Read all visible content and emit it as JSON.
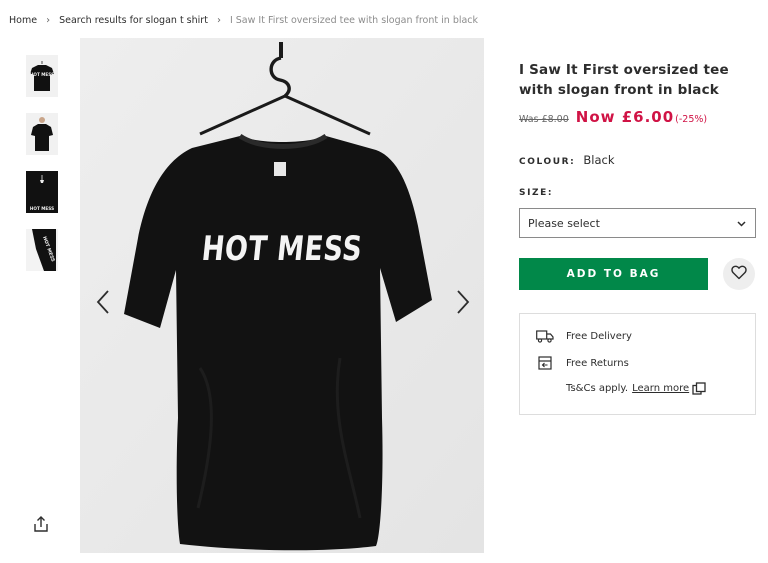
{
  "breadcrumb": {
    "home": "Home",
    "search": "Search results for slogan t shirt",
    "current": "I Saw It First oversized tee with slogan front in black",
    "separator": "›"
  },
  "gallery": {
    "thumbnails": [
      "front-view",
      "model-view",
      "back-view",
      "sleeve-view"
    ],
    "thumb_slogans": [
      "HOT MESS",
      "HOT MESS",
      "HOT MESS"
    ],
    "main_slogan": "HOT MESS",
    "prev_icon": "chevron-left-icon",
    "next_icon": "chevron-right-icon",
    "share_icon": "share-icon"
  },
  "product": {
    "title": "I Saw It First oversized tee with slogan front in black",
    "was_price": "Was £8.00",
    "now_price": "Now £6.00",
    "discount": "(-25%)",
    "colour_label": "COLOUR:",
    "colour_value": "Black",
    "size_label": "SIZE:",
    "size_selected": "Please select",
    "add_to_bag": "ADD TO BAG",
    "wishlist_icon": "heart-icon"
  },
  "delivery": {
    "free_delivery": "Free Delivery",
    "free_returns": "Free Returns",
    "tcs": "Ts&Cs apply.",
    "learn_more": "Learn more"
  },
  "colors": {
    "price_red": "#d01345",
    "add_green": "#018849",
    "text": "#2d2d2d"
  }
}
